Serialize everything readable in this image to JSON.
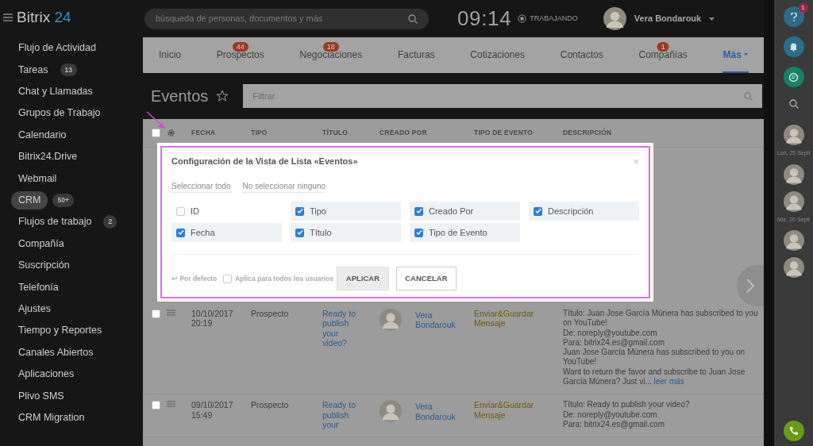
{
  "logo": {
    "name": "Bitrix",
    "number": "24"
  },
  "header": {
    "search_placeholder": "búsqueda de personas, documentos y más",
    "clock": "09:14",
    "status": "TRABAJANDO",
    "user": "Vera Bondarouk"
  },
  "sidebar": {
    "items": [
      {
        "label": "Flujo de Actividad",
        "selected": false
      },
      {
        "label": "Tareas",
        "badge": "13",
        "selected": false
      },
      {
        "label": "Chat y Llamadas",
        "selected": false
      },
      {
        "label": "Grupos de Trabajo",
        "selected": false
      },
      {
        "label": "Calendario",
        "selected": false
      },
      {
        "label": "Bitrix24.Drive",
        "selected": false
      },
      {
        "label": "Webmail",
        "selected": false
      },
      {
        "label": "CRM",
        "badge": "50+",
        "selected": true
      },
      {
        "label": "Flujos de trabajo",
        "badge": "2",
        "selected": false
      },
      {
        "label": "Compañía",
        "selected": false
      },
      {
        "label": "Suscripción",
        "selected": false
      },
      {
        "label": "Telefonía",
        "selected": false
      },
      {
        "label": "Ajustes",
        "selected": false
      },
      {
        "label": "Tiempo y Reportes",
        "selected": false
      },
      {
        "label": "Canales Abiertos",
        "selected": false
      },
      {
        "label": "Aplicaciones",
        "selected": false
      },
      {
        "label": "Plivo SMS",
        "selected": false
      },
      {
        "label": "CRM Migration",
        "selected": false
      }
    ]
  },
  "tabs": [
    {
      "label": "Inicio",
      "selected": false
    },
    {
      "label": "Prospectos",
      "badge": "44",
      "selected": false
    },
    {
      "label": "Negociaciones",
      "badge": "18",
      "selected": false
    },
    {
      "label": "Facturas",
      "selected": false
    },
    {
      "label": "Cotizaciones",
      "selected": false
    },
    {
      "label": "Contactos",
      "selected": false
    },
    {
      "label": "Compañías",
      "badge": "1",
      "selected": false
    },
    {
      "label": "Más",
      "selected": true
    }
  ],
  "page": {
    "title": "Eventos",
    "filter_placeholder": "Filtrar"
  },
  "table": {
    "all_checked": false,
    "columns": [
      "FECHA",
      "TIPO",
      "TÍTULO",
      "CREADO POR",
      "TIPO DE EVENTO",
      "DESCRIPCIÓN"
    ],
    "rows": [
      {
        "checked": false,
        "date": "10/10/2017",
        "time": "20:19",
        "type": "Prospecto",
        "title": "Ready to publish your video?",
        "created_by": "Vera Bondarouk",
        "event_type": "Enviar&Guardar Mensaje",
        "description": [
          "Título: Juan Jose García Múnera has subscribed to you on YouTube!",
          "De: noreply@youtube.com",
          "Para: bitrix24.es@gmail.com",
          "Juan Jose García Múnera has subscribed to you on YouTube!",
          "Want to return the favor and subscribe to Juan Jose García Múnera? Just vi..."
        ],
        "more": "leer más"
      },
      {
        "checked": false,
        "date": "09/10/2017",
        "time": "15:49",
        "type": "Prospecto",
        "title": "Ready to publish your",
        "created_by": "Vera Bondarouk",
        "event_type": "Enviar&Guardar Mensaje",
        "description": [
          "Título: Ready to publish your video?",
          "De: noreply@youtube.com",
          "Para: bitrix24.es@gmail.com"
        ]
      }
    ]
  },
  "dialog": {
    "title": "Configuración de la Vista de Lista «Eventos»",
    "close": "×",
    "select_all": "Seleccionar todo",
    "select_none": "No seleccionar ninguno",
    "fields": [
      {
        "label": "ID",
        "checked": false
      },
      {
        "label": "Tipo",
        "checked": true
      },
      {
        "label": "Creado Por",
        "checked": true
      },
      {
        "label": "Descripción",
        "checked": true
      },
      {
        "label": "Fecha",
        "checked": true
      },
      {
        "label": "Título",
        "checked": true
      },
      {
        "label": "Tipo de Evento",
        "checked": true
      }
    ],
    "reset_icon": "↩",
    "reset": "Por defecto",
    "apply_all": {
      "label": "Aplica para todos los usuarios",
      "checked": false
    },
    "buttons": [
      "APLICAR",
      "CANCELAR"
    ]
  },
  "right_bar": {
    "help_badge": "1",
    "dates": [
      "Lun, 25 Septi",
      "Mie, 20 Septi"
    ]
  }
}
